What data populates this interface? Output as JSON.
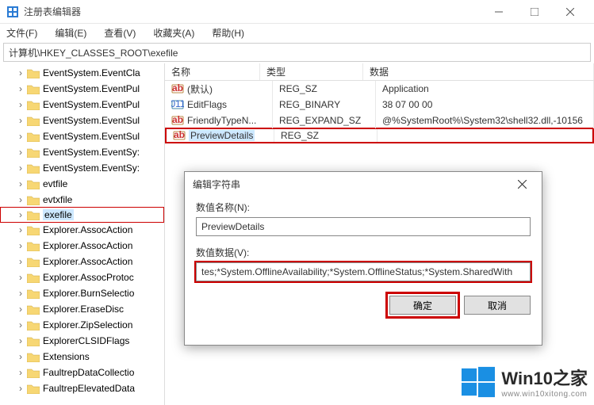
{
  "window": {
    "title": "注册表编辑器"
  },
  "menu": {
    "file": "文件(F)",
    "edit": "编辑(E)",
    "view": "查看(V)",
    "favorites": "收藏夹(A)",
    "help": "帮助(H)"
  },
  "addressbar": "计算机\\HKEY_CLASSES_ROOT\\exefile",
  "tree": {
    "items": [
      "EventSystem.EventCla",
      "EventSystem.EventPul",
      "EventSystem.EventPul",
      "EventSystem.EventSul",
      "EventSystem.EventSul",
      "EventSystem.EventSy:",
      "EventSystem.EventSy:",
      "evtfile",
      "evtxfile",
      "exefile",
      "Explorer.AssocAction",
      "Explorer.AssocAction",
      "Explorer.AssocAction",
      "Explorer.AssocProtoc",
      "Explorer.BurnSelectio",
      "Explorer.EraseDisc",
      "Explorer.ZipSelection",
      "ExplorerCLSIDFlags",
      "Extensions",
      "FaultrepDataCollectio",
      "FaultrepElevatedData"
    ],
    "selected_index": 9
  },
  "list": {
    "headers": {
      "name": "名称",
      "type": "类型",
      "data": "数据"
    },
    "rows": [
      {
        "name": "(默认)",
        "type": "REG_SZ",
        "data": "Application",
        "icon": "ab"
      },
      {
        "name": "EditFlags",
        "type": "REG_BINARY",
        "data": "38 07 00 00",
        "icon": "bin"
      },
      {
        "name": "FriendlyTypeN...",
        "type": "REG_EXPAND_SZ",
        "data": "@%SystemRoot%\\System32\\shell32.dll,-10156",
        "icon": "ab"
      },
      {
        "name": "PreviewDetails",
        "type": "REG_SZ",
        "data": "",
        "icon": "ab"
      }
    ],
    "selected_index": 3
  },
  "dialog": {
    "title": "编辑字符串",
    "name_label": "数值名称(N):",
    "name_value": "PreviewDetails",
    "data_label": "数值数据(V):",
    "data_value": "tes;*System.OfflineAvailability;*System.OfflineStatus;*System.SharedWith",
    "ok": "确定",
    "cancel": "取消"
  },
  "watermark": {
    "brand": "Win10之家",
    "url": "www.win10xitong.com"
  }
}
